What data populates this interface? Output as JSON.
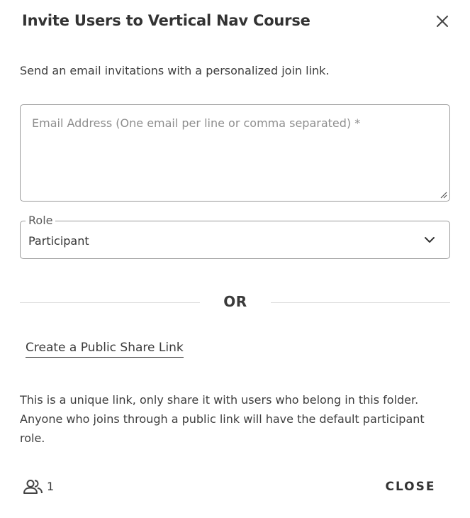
{
  "dialog": {
    "title": "Invite Users to Vertical Nav Course",
    "close_icon": "close-icon",
    "intro_text": "Send an email invitations with a personalized join link."
  },
  "email_field": {
    "placeholder": "Email Address (One email per line or comma separated) *",
    "value": ""
  },
  "role_select": {
    "label": "Role",
    "selected": "Participant",
    "icon": "chevron-down-icon"
  },
  "separator": {
    "text": "OR"
  },
  "public_link": {
    "label": "Create a Public Share Link"
  },
  "note": {
    "text": "This is a unique link, only share it with users who belong in this folder. Anyone who joins through a public link will have the default participant role."
  },
  "footer": {
    "users_icon": "users-icon",
    "user_count": "1",
    "close_label": "CLOSE"
  }
}
